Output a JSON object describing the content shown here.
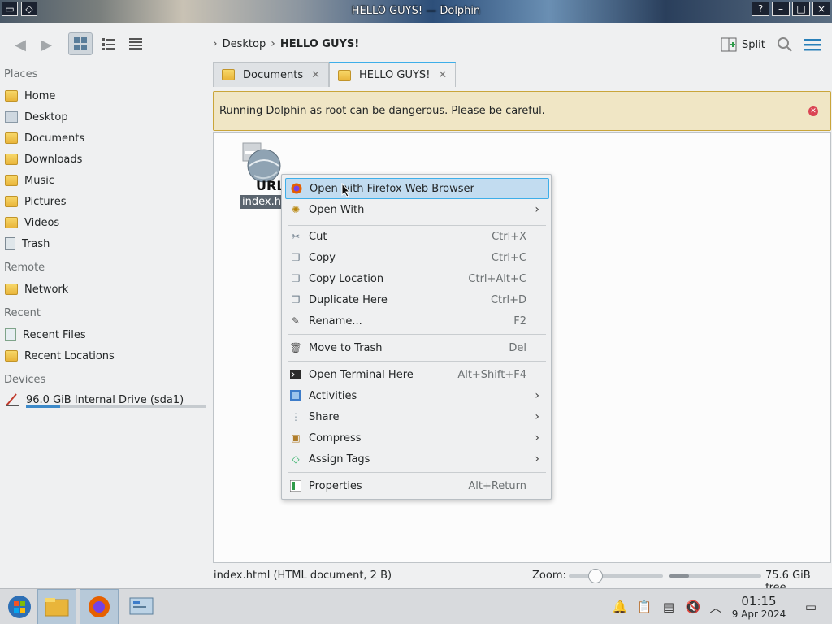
{
  "window": {
    "title": "HELLO GUYS! — Dolphin"
  },
  "titlebar_buttons": [
    "?",
    "–",
    "□",
    "×"
  ],
  "breadcrumb": {
    "parent": "Desktop",
    "current": "HELLO GUYS!"
  },
  "toolbar": {
    "split_label": "Split"
  },
  "sidebar": {
    "places_title": "Places",
    "places": [
      {
        "label": "Home",
        "icon": "home-folder-icon"
      },
      {
        "label": "Desktop",
        "icon": "desktop-icon"
      },
      {
        "label": "Documents",
        "icon": "documents-folder-icon"
      },
      {
        "label": "Downloads",
        "icon": "downloads-folder-icon"
      },
      {
        "label": "Music",
        "icon": "music-folder-icon"
      },
      {
        "label": "Pictures",
        "icon": "pictures-folder-icon"
      },
      {
        "label": "Videos",
        "icon": "videos-folder-icon"
      },
      {
        "label": "Trash",
        "icon": "trash-icon"
      }
    ],
    "remote_title": "Remote",
    "remote": [
      {
        "label": "Network",
        "icon": "network-folder-icon"
      }
    ],
    "recent_title": "Recent",
    "recent": [
      {
        "label": "Recent Files",
        "icon": "recent-files-icon"
      },
      {
        "label": "Recent Locations",
        "icon": "recent-locations-icon"
      }
    ],
    "devices_title": "Devices",
    "devices": [
      {
        "label": "96.0 GiB Internal Drive (sda1)",
        "icon": "drive-icon",
        "used_fraction": 0.19
      }
    ]
  },
  "tabs": [
    {
      "label": "Documents",
      "active": false
    },
    {
      "label": "HELLO GUYS!",
      "active": true
    }
  ],
  "banner": {
    "text": "Running Dolphin as root can be dangerous. Please be careful."
  },
  "file": {
    "name": "index.ht",
    "icon_text": "URL"
  },
  "context_menu": {
    "items": [
      {
        "label": "Open with Firefox Web Browser",
        "shortcut": "",
        "submenu": false,
        "highlighted": true,
        "icon": "firefox-icon"
      },
      {
        "label": "Open With",
        "shortcut": "",
        "submenu": true,
        "icon": "open-with-icon"
      },
      {
        "label": "Cut",
        "shortcut": "Ctrl+X",
        "submenu": false,
        "icon": "cut-icon"
      },
      {
        "label": "Copy",
        "shortcut": "Ctrl+C",
        "submenu": false,
        "icon": "copy-icon"
      },
      {
        "label": "Copy Location",
        "shortcut": "Ctrl+Alt+C",
        "submenu": false,
        "icon": "copy-location-icon"
      },
      {
        "label": "Duplicate Here",
        "shortcut": "Ctrl+D",
        "submenu": false,
        "icon": "duplicate-icon"
      },
      {
        "label": "Rename...",
        "shortcut": "F2",
        "submenu": false,
        "icon": "rename-icon"
      },
      {
        "label": "Move to Trash",
        "shortcut": "Del",
        "submenu": false,
        "icon": "trash-icon"
      },
      {
        "label": "Open Terminal Here",
        "shortcut": "Alt+Shift+F4",
        "submenu": false,
        "icon": "terminal-icon"
      },
      {
        "label": "Activities",
        "shortcut": "",
        "submenu": true,
        "icon": "activities-icon"
      },
      {
        "label": "Share",
        "shortcut": "",
        "submenu": true,
        "icon": "share-icon"
      },
      {
        "label": "Compress",
        "shortcut": "",
        "submenu": true,
        "icon": "compress-icon"
      },
      {
        "label": "Assign Tags",
        "shortcut": "",
        "submenu": true,
        "icon": "tag-icon"
      },
      {
        "label": "Properties",
        "shortcut": "Alt+Return",
        "submenu": false,
        "icon": "properties-icon"
      }
    ]
  },
  "statusbar": {
    "info": "index.html (HTML document, 2 B)",
    "zoom_label": "Zoom:",
    "free": "75.6 GiB free"
  },
  "taskbar": {
    "time": "01:15",
    "date": "9 Apr 2024"
  },
  "colors": {
    "accent": "#3daee9",
    "highlight": "#c2dcf0",
    "banner_bg": "#f0e6c5",
    "banner_border": "#c9a53a"
  }
}
